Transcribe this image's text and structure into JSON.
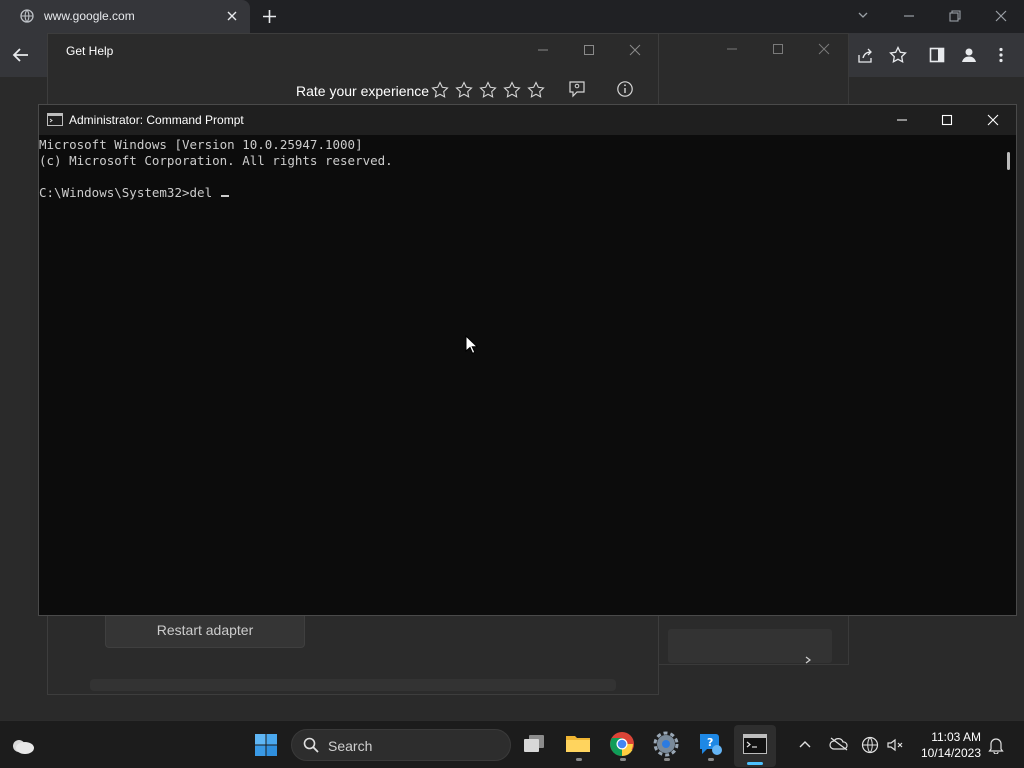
{
  "browser": {
    "tab_title": "www.google.com",
    "accent": "#35363a"
  },
  "gethelp": {
    "title": "Get Help",
    "rate_label": "Rate your experience",
    "stars": 5,
    "restart_label": "Restart adapter"
  },
  "cmd": {
    "title": "Administrator: Command Prompt",
    "lines": [
      "Microsoft Windows [Version 10.0.25947.1000]",
      "(c) Microsoft Corporation. All rights reserved.",
      "",
      "C:\\Windows\\System32>del "
    ]
  },
  "taskbar": {
    "search_label": "Search",
    "time": "11:03 AM",
    "date": "10/14/2023",
    "active_accent": "#4cc2ff"
  },
  "icons": [
    "weather-icon",
    "windows-start-icon",
    "search-icon",
    "task-view-icon",
    "file-explorer-icon",
    "chrome-icon",
    "settings-icon",
    "get-help-icon",
    "command-prompt-icon",
    "chevron-up-icon",
    "onedrive-icon",
    "network-icon",
    "volume-muted-icon",
    "notification-bell-icon"
  ]
}
